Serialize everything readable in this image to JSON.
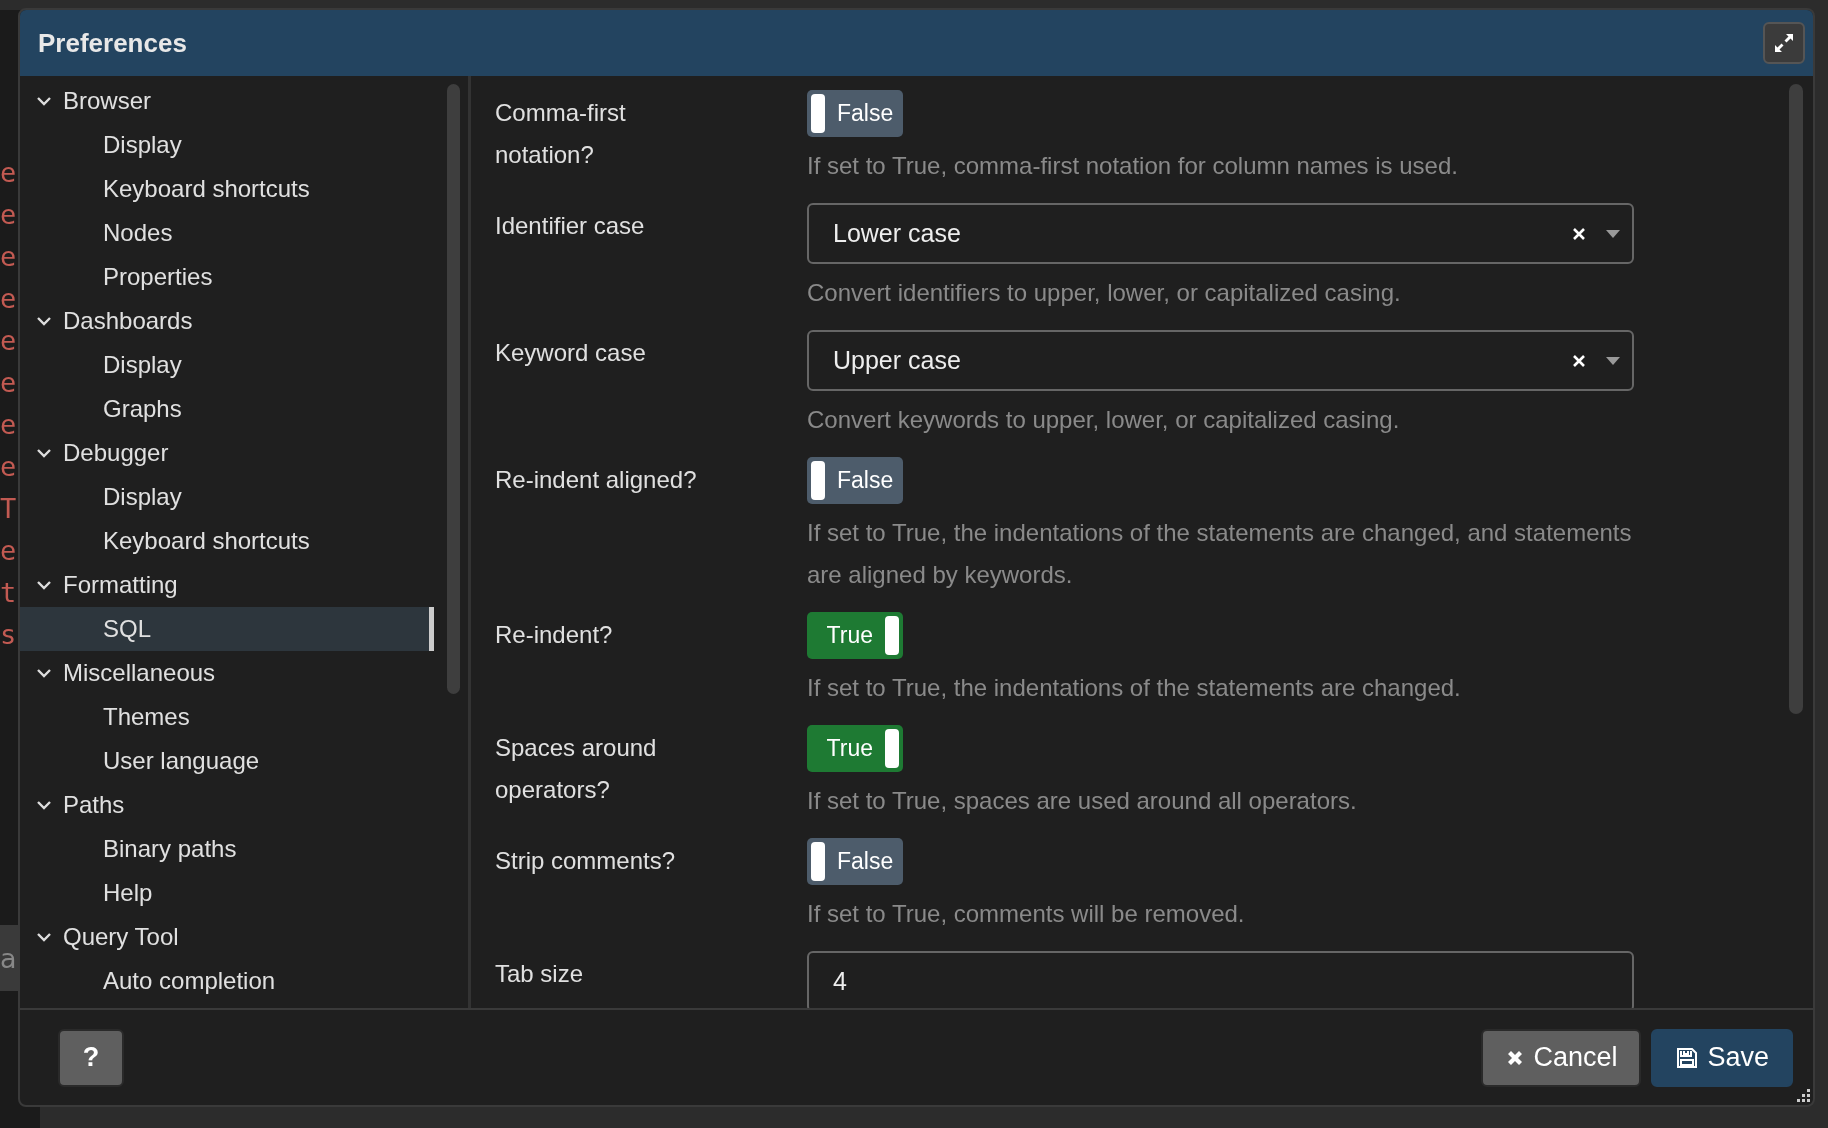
{
  "window": {
    "title": "Preferences"
  },
  "background": {
    "fragments": [
      "e",
      "e",
      "e",
      "e",
      "e",
      "e",
      "e",
      "e",
      "T",
      "e",
      "t",
      "s"
    ],
    "status": "a"
  },
  "tree": [
    {
      "label": "Browser",
      "expanded": true,
      "selected": false,
      "children": [
        {
          "label": "Display",
          "selected": false
        },
        {
          "label": "Keyboard shortcuts",
          "selected": false
        },
        {
          "label": "Nodes",
          "selected": false
        },
        {
          "label": "Properties",
          "selected": false
        }
      ]
    },
    {
      "label": "Dashboards",
      "expanded": true,
      "selected": false,
      "children": [
        {
          "label": "Display",
          "selected": false
        },
        {
          "label": "Graphs",
          "selected": false
        }
      ]
    },
    {
      "label": "Debugger",
      "expanded": true,
      "selected": false,
      "children": [
        {
          "label": "Display",
          "selected": false
        },
        {
          "label": "Keyboard shortcuts",
          "selected": false
        }
      ]
    },
    {
      "label": "Formatting",
      "expanded": true,
      "selected": false,
      "children": [
        {
          "label": "SQL",
          "selected": true
        }
      ]
    },
    {
      "label": "Miscellaneous",
      "expanded": true,
      "selected": false,
      "children": [
        {
          "label": "Themes",
          "selected": false
        },
        {
          "label": "User language",
          "selected": false
        }
      ]
    },
    {
      "label": "Paths",
      "expanded": true,
      "selected": false,
      "children": [
        {
          "label": "Binary paths",
          "selected": false
        },
        {
          "label": "Help",
          "selected": false
        }
      ]
    },
    {
      "label": "Query Tool",
      "expanded": true,
      "selected": false,
      "children": [
        {
          "label": "Auto completion",
          "selected": false
        }
      ]
    }
  ],
  "settings": [
    {
      "kind": "toggle",
      "label": "Comma-first notation?",
      "on": false,
      "value": "False",
      "help": "If set to True, comma-first notation for column names is used."
    },
    {
      "kind": "select",
      "label": "Identifier case",
      "value": "Lower case",
      "help": "Convert identifiers to upper, lower, or capitalized casing."
    },
    {
      "kind": "select",
      "label": "Keyword case",
      "value": "Upper case",
      "help": "Convert keywords to upper, lower, or capitalized casing."
    },
    {
      "kind": "toggle",
      "label": "Re-indent aligned?",
      "on": false,
      "value": "False",
      "help": "If set to True, the indentations of the statements are changed, and statements are aligned by keywords."
    },
    {
      "kind": "toggle",
      "label": "Re-indent?",
      "on": true,
      "value": "True",
      "help": "If set to True, the indentations of the statements are changed."
    },
    {
      "kind": "toggle",
      "label": "Spaces around operators?",
      "on": true,
      "value": "True",
      "help": "If set to True, spaces are used around all operators."
    },
    {
      "kind": "toggle",
      "label": "Strip comments?",
      "on": false,
      "value": "False",
      "help": "If set to True, comments will be removed."
    },
    {
      "kind": "input",
      "label": "Tab size",
      "value": "4"
    }
  ],
  "buttons": {
    "help": "?",
    "cancel": "Cancel",
    "save": "Save"
  }
}
